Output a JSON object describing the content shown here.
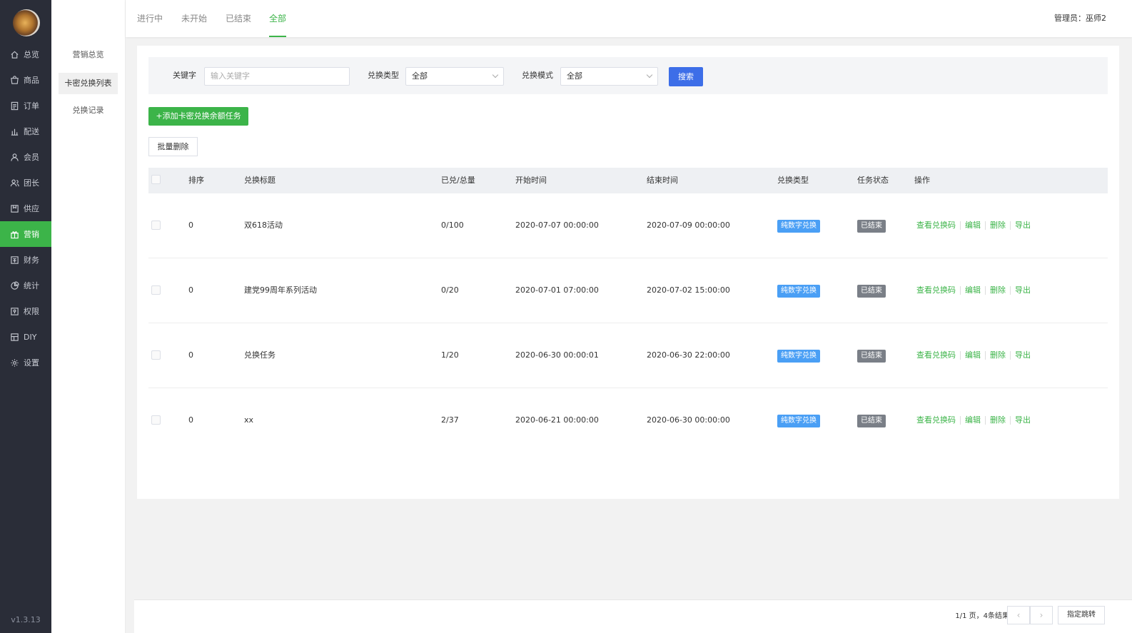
{
  "sidebar": {
    "items": [
      {
        "label": "总览",
        "icon": "home-icon"
      },
      {
        "label": "商品",
        "icon": "goods-icon"
      },
      {
        "label": "订单",
        "icon": "order-icon"
      },
      {
        "label": "配送",
        "icon": "delivery-icon"
      },
      {
        "label": "会员",
        "icon": "member-icon"
      },
      {
        "label": "团长",
        "icon": "leader-icon"
      },
      {
        "label": "供应",
        "icon": "supply-icon"
      },
      {
        "label": "营销",
        "icon": "gift-icon"
      },
      {
        "label": "财务",
        "icon": "finance-icon"
      },
      {
        "label": "统计",
        "icon": "stats-icon"
      },
      {
        "label": "权限",
        "icon": "permission-icon"
      },
      {
        "label": "DIY",
        "icon": "diy-icon"
      },
      {
        "label": "设置",
        "icon": "gear-icon"
      }
    ],
    "version": "v1.3.13"
  },
  "subnav": {
    "items": [
      "营销总览",
      "卡密兑换列表",
      "兑换记录"
    ]
  },
  "topbar": {
    "tabs": [
      "进行中",
      "未开始",
      "已结束",
      "全部"
    ],
    "admin": "管理员：巫师2"
  },
  "filter": {
    "keyword_label": "关键字",
    "keyword_placeholder": "输入关键字",
    "type_label": "兑换类型",
    "type_value": "全部",
    "mode_label": "兑换模式",
    "mode_value": "全部",
    "search_label": "搜索"
  },
  "actions": {
    "add_label": "+添加卡密兑换余额任务",
    "batch_delete_label": "批量删除"
  },
  "table": {
    "headers": [
      "排序",
      "兑换标题",
      "已兑/总量",
      "开始时间",
      "结束时间",
      "兑换类型",
      "任务状态",
      "操作"
    ],
    "rows": [
      {
        "sort": "0",
        "title": "双618活动",
        "count": "0/100",
        "start": "2020-07-07 00:00:00",
        "end": "2020-07-09 00:00:00",
        "type": "纯数字兑换",
        "status": "已结束"
      },
      {
        "sort": "0",
        "title": "建党99周年系列活动",
        "count": "0/20",
        "start": "2020-07-01 07:00:00",
        "end": "2020-07-02 15:00:00",
        "type": "纯数字兑换",
        "status": "已结束"
      },
      {
        "sort": "0",
        "title": "兑换任务",
        "count": "1/20",
        "start": "2020-06-30 00:00:01",
        "end": "2020-06-30 22:00:00",
        "type": "纯数字兑换",
        "status": "已结束"
      },
      {
        "sort": "0",
        "title": "xx",
        "count": "2/37",
        "start": "2020-06-21 00:00:00",
        "end": "2020-06-30 00:00:00",
        "type": "纯数字兑换",
        "status": "已结束"
      }
    ],
    "ops": [
      "查看兑换码",
      "编辑",
      "删除",
      "导出"
    ]
  },
  "pagination": {
    "info": "1/1 页，4条结果",
    "prev": "‹",
    "next": "›",
    "jump_label": "指定跳转"
  },
  "colors": {
    "accent": "#3cb449",
    "sidebar_bg": "#2a2d38",
    "search_button": "#3d6ee8",
    "type_tag": "#4a9ff5",
    "status_tag": "#7a7f87"
  }
}
